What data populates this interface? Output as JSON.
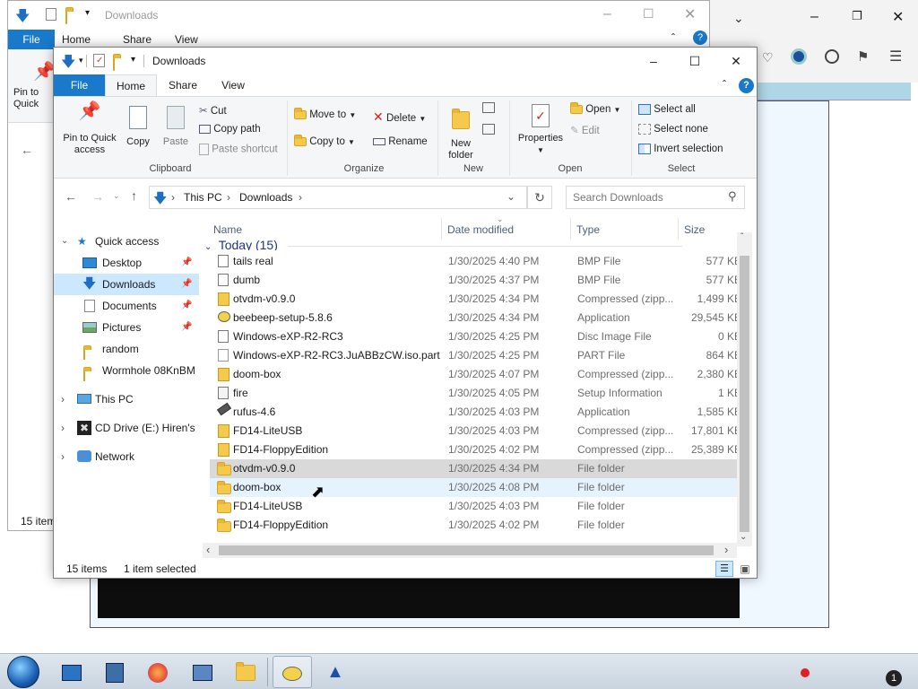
{
  "browser": {
    "toolbar_icons": [
      "pocket-icon",
      "firefox-account-icon",
      "account-icon",
      "extensions-icon",
      "menu-icon"
    ]
  },
  "back_window": {
    "title": "Downloads",
    "tabs": [
      "File",
      "Home",
      "Share",
      "View"
    ],
    "pin_label": "Pin to Quick access",
    "status": "15 item"
  },
  "window": {
    "title": "Downloads",
    "tabs": {
      "file": "File",
      "home": "Home",
      "share": "Share",
      "view": "View"
    },
    "ribbon": {
      "pin": "Pin to Quick access",
      "copy": "Copy",
      "paste": "Paste",
      "cut": "Cut",
      "copy_path": "Copy path",
      "paste_shortcut": "Paste shortcut",
      "clipboard": "Clipboard",
      "move_to": "Move to",
      "copy_to": "Copy to",
      "delete": "Delete",
      "rename": "Rename",
      "organize": "Organize",
      "new_folder": "New folder",
      "new": "New",
      "properties": "Properties",
      "open": "Open",
      "edit": "Edit",
      "open_group": "Open",
      "select_all": "Select all",
      "select_none": "Select none",
      "invert_selection": "Invert selection",
      "select": "Select"
    },
    "address": {
      "this_pc": "This PC",
      "downloads": "Downloads"
    },
    "search_placeholder": "Search Downloads",
    "nav": {
      "quick_access": "Quick access",
      "desktop": "Desktop",
      "downloads": "Downloads",
      "documents": "Documents",
      "pictures": "Pictures",
      "random": "random",
      "wormhole": "Wormhole 08KnBM",
      "this_pc": "This PC",
      "cd_drive": "CD Drive (E:) Hiren's I",
      "network": "Network"
    },
    "columns": {
      "name": "Name",
      "date": "Date modified",
      "type": "Type",
      "size": "Size"
    },
    "group": "Today (15)",
    "files": [
      {
        "name": "tails real",
        "date": "1/30/2025 4:40 PM",
        "type": "BMP File",
        "size": "577 KB",
        "icon": "bmp-file-icon"
      },
      {
        "name": "dumb",
        "date": "1/30/2025 4:37 PM",
        "type": "BMP File",
        "size": "577 KB",
        "icon": "bmp-file-icon"
      },
      {
        "name": "otvdm-v0.9.0",
        "date": "1/30/2025 4:34 PM",
        "type": "Compressed (zipp...",
        "size": "1,499 KB",
        "icon": "zip-file-icon"
      },
      {
        "name": "beebeep-setup-5.8.6",
        "date": "1/30/2025 4:34 PM",
        "type": "Application",
        "size": "29,545 KB",
        "icon": "bee-app-icon"
      },
      {
        "name": "Windows-eXP-R2-RC3",
        "date": "1/30/2025 4:25 PM",
        "type": "Disc Image File",
        "size": "0 KB",
        "icon": "disc-image-icon"
      },
      {
        "name": "Windows-eXP-R2-RC3.JuABBzCW.iso.part",
        "date": "1/30/2025 4:25 PM",
        "type": "PART File",
        "size": "864 KB",
        "icon": "blank-file-icon"
      },
      {
        "name": "doom-box",
        "date": "1/30/2025 4:07 PM",
        "type": "Compressed (zipp...",
        "size": "2,380 KB",
        "icon": "zip-file-icon"
      },
      {
        "name": "fire",
        "date": "1/30/2025 4:05 PM",
        "type": "Setup Information",
        "size": "1 KB",
        "icon": "setup-info-icon"
      },
      {
        "name": "rufus-4.6",
        "date": "1/30/2025 4:03 PM",
        "type": "Application",
        "size": "1,585 KB",
        "icon": "usb-app-icon"
      },
      {
        "name": "FD14-LiteUSB",
        "date": "1/30/2025 4:03 PM",
        "type": "Compressed (zipp...",
        "size": "17,801 KB",
        "icon": "zip-file-icon"
      },
      {
        "name": "FD14-FloppyEdition",
        "date": "1/30/2025 4:02 PM",
        "type": "Compressed (zipp...",
        "size": "25,389 KB",
        "icon": "zip-file-icon"
      },
      {
        "name": "otvdm-v0.9.0",
        "date": "1/30/2025 4:34 PM",
        "type": "File folder",
        "size": "",
        "icon": "folder-icon"
      },
      {
        "name": "doom-box",
        "date": "1/30/2025 4:08 PM",
        "type": "File folder",
        "size": "",
        "icon": "folder-icon"
      },
      {
        "name": "FD14-LiteUSB",
        "date": "1/30/2025 4:03 PM",
        "type": "File folder",
        "size": "",
        "icon": "folder-icon"
      },
      {
        "name": "FD14-FloppyEdition",
        "date": "1/30/2025 4:02 PM",
        "type": "File folder",
        "size": "",
        "icon": "folder-icon"
      }
    ],
    "status": {
      "count": "15 items",
      "selected": "1 item selected"
    }
  },
  "taskbar": {
    "items": [
      "start-orb-icon",
      "window-manager-icon",
      "server-icon",
      "firefox-icon",
      "network-computer-icon",
      "file-explorer-icon",
      "bee-icon",
      "vpn-arrow-icon"
    ],
    "tray_badge": "1"
  },
  "colors": {
    "accent": "#1979ca",
    "selection": "#cce8ff",
    "row_selected": "#d9d9d9",
    "row_hover": "#e5f3ff"
  }
}
